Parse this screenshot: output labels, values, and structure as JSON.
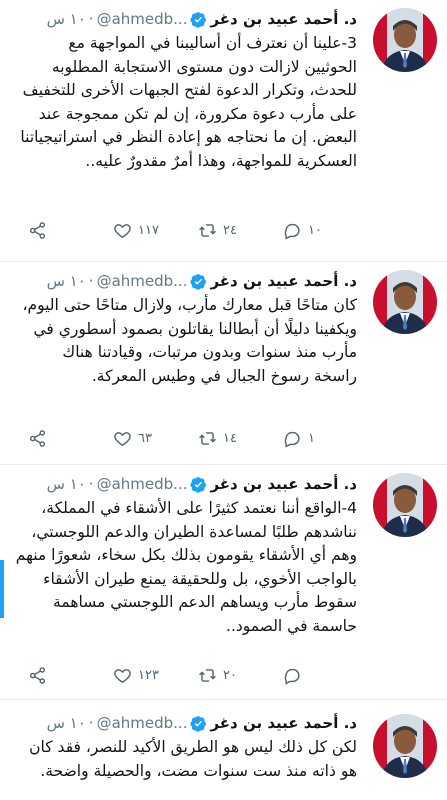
{
  "tweets": [
    {
      "name": "د. أحمد عبيد بن دغر",
      "handle": "@ahmedb...",
      "time": "١٠ س",
      "text": "3-علينا أن نعترف أن أساليبنا في المواجهة مع الحوثيين لازالت دون مستوى الاستجابة المطلوبه للحدث، وتكرار الدعوة لفتح الجبهات الأخرى للتخفيف على مأرب دعوة مكرورة، إن لم تكن ممجوجة عند البعض. إن ما نحتاجه هو إعادة النظر في استراتيجياتنا العسكرية للمواجهة، وهذا أمرٌ مقدورٌ عليه..",
      "replies": "١٠",
      "retweets": "٢٤",
      "likes": "١١٧"
    },
    {
      "name": "د. أحمد عبيد بن دغر",
      "handle": "@ahmedb...",
      "time": "١٠ س",
      "text": "كان متاحًا قبل معارك مأرب، ولازال متاحًا حتى اليوم، ويكفينا دليلًا أن أبطالنا يقاتلون بصمود أسطوري في مأرب منذ سنوات وبدون مرتبات، وقيادتنا هناك راسخة رسوخ الجبال في وطيس المعركة.",
      "replies": "١",
      "retweets": "١٤",
      "likes": "٦٣"
    },
    {
      "name": "د. أحمد عبيد بن دغر",
      "handle": "@ahmedb...",
      "time": "١٠ س",
      "text": "4-الواقع أننا نعتمد كثيرًا على الأشقاء في المملكة، نناشدهم طلبًا لمساعدة الطيران والدعم اللوجستي، وهم أي الأشقاء يقومون بذلك بكل سخاء، شعورًا منهم بالواجب الأخوي، بل وللحقيقة يمنع طيران الأشقاء سقوط مأرب ويساهم الدعم اللوجستي مساهمة حاسمة في الصمود..",
      "replies": "",
      "retweets": "٢٠",
      "likes": "١٢٣"
    },
    {
      "name": "د. أحمد عبيد بن دغر",
      "handle": "@ahmedb...",
      "time": "١٠ س",
      "text": "لكن كل ذلك ليس هو الطريق الأكيد للنصر، فقد كان هو ذاته منذ ست سنوات مضت، والحصيلة واضحة.",
      "replies": "",
      "retweets": "",
      "likes": ""
    }
  ],
  "colors": {
    "verified": "#1da1f2",
    "muted": "#657786",
    "divider": "#e6ecf0"
  },
  "icons": [
    "verified-icon",
    "reply-icon",
    "retweet-icon",
    "like-icon",
    "share-icon"
  ]
}
